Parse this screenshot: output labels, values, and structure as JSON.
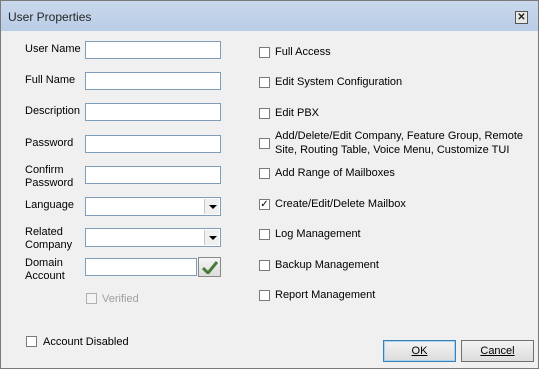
{
  "window": {
    "title": "User Properties",
    "close_glyph": "✕"
  },
  "form": {
    "user_name_label": "User Name",
    "full_name_label": "Full Name",
    "description_label": "Description",
    "password_label": "Password",
    "confirm_password_label": "Confirm Password",
    "language_label": "Language",
    "related_company_label": "Related Company",
    "domain_account_label": "Domain Account",
    "user_name": "",
    "full_name": "",
    "description": "",
    "password": "",
    "confirm_password": "",
    "language": "",
    "related_company": "",
    "domain_account": "",
    "verified_label": "Verified",
    "verified_checked": false,
    "account_disabled_label": "Account Disabled",
    "account_disabled_checked": false
  },
  "permissions": [
    {
      "label": "Full Access",
      "checked": false
    },
    {
      "label": "Edit System Configuration",
      "checked": false
    },
    {
      "label": "Edit PBX",
      "checked": false
    },
    {
      "label": "Add/Delete/Edit Company, Feature Group, Remote Site, Routing Table, Voice Menu, Customize TUI",
      "checked": false
    },
    {
      "label": "Add Range of Mailboxes",
      "checked": false
    },
    {
      "label": "Create/Edit/Delete Mailbox",
      "checked": true
    },
    {
      "label": "Log Management",
      "checked": false
    },
    {
      "label": "Backup Management",
      "checked": false
    },
    {
      "label": "Report Management",
      "checked": false
    }
  ],
  "buttons": {
    "ok": "OK",
    "cancel": "Cancel"
  },
  "icons": {
    "verify": "checkmark-icon",
    "dropdown": "chevron-down-icon",
    "close": "close-icon"
  }
}
